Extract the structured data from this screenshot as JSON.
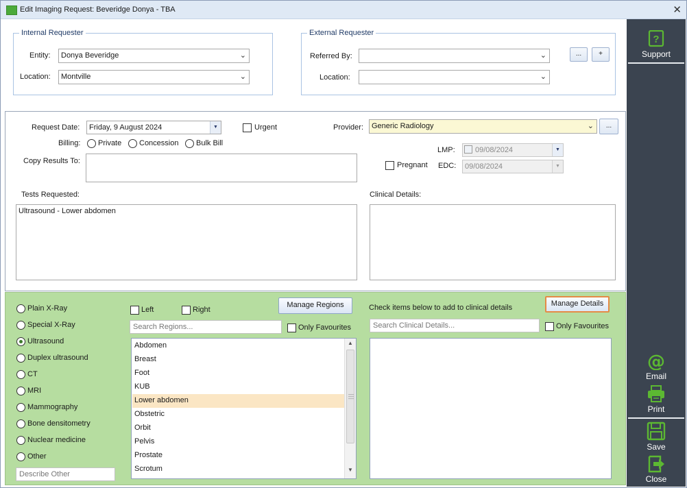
{
  "window": {
    "title": "Edit Imaging Request: Beveridge Donya - TBA",
    "close_glyph": "✕"
  },
  "internal_requester": {
    "legend": "Internal Requester",
    "entity_label": "Entity:",
    "entity_value": "Donya Beveridge",
    "location_label": "Location:",
    "location_value": "Montville"
  },
  "external_requester": {
    "legend": "External Requester",
    "referred_by_label": "Referred By:",
    "referred_by_value": "",
    "location_label": "Location:",
    "location_value": "",
    "browse_button": "...",
    "add_button": "+"
  },
  "request": {
    "date_label": "Request Date:",
    "date_value": "Friday, 9 August 2024",
    "urgent_label": "Urgent",
    "provider_label": "Provider:",
    "provider_value": "Generic Radiology",
    "provider_browse": "...",
    "billing_label": "Billing:",
    "billing_options": [
      "Private",
      "Concession",
      "Bulk Bill"
    ],
    "copy_results_label": "Copy Results To:",
    "copy_results_value": "",
    "lmp_label": "LMP:",
    "lmp_value": "09/08/2024",
    "pregnant_label": "Pregnant",
    "edc_label": "EDC:",
    "edc_value": "09/08/2024",
    "tests_label": "Tests Requested:",
    "tests_value": "Ultrasound - Lower abdomen",
    "clinical_label": "Clinical Details:",
    "clinical_value": ""
  },
  "modalities": {
    "selected": "Ultrasound",
    "options": [
      "Plain X-Ray",
      "Special X-Ray",
      "Ultrasound",
      "Duplex ultrasound",
      "CT",
      "MRI",
      "Mammography",
      "Bone densitometry",
      "Nuclear medicine",
      "Other"
    ],
    "describe_other_placeholder": "Describe Other"
  },
  "regions": {
    "left_label": "Left",
    "right_label": "Right",
    "manage_button": "Manage Regions",
    "search_placeholder": "Search Regions...",
    "only_favourites_label": "Only Favourites",
    "selected": "Lower abdomen",
    "items": [
      "Abdomen",
      "Breast",
      "Foot",
      "KUB",
      "Lower abdomen",
      "Obstetric",
      "Orbit",
      "Pelvis",
      "Prostate",
      "Scrotum"
    ]
  },
  "clinical_details": {
    "instruction": "Check items below to add to clinical details",
    "manage_button": "Manage Details",
    "search_placeholder": "Search Clinical Details...",
    "only_favourites_label": "Only Favourites"
  },
  "sidebar": {
    "support": "Support",
    "email": "Email",
    "print": "Print",
    "save": "Save",
    "close": "Close",
    "accent_color": "#5cb832",
    "background_color": "#3b4450"
  }
}
